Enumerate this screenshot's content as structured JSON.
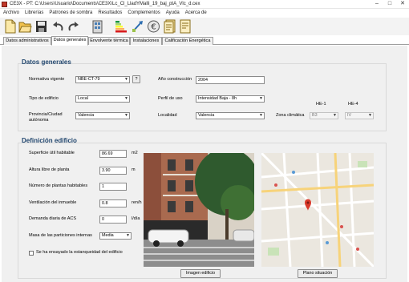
{
  "window": {
    "title": "CE3X - PT: C:\\Users\\Usuario\\Documents\\CE3X\\Lc_Cl_LladYMalli_19_baj_ptA_Vlc_d.cex",
    "controls": [
      "–",
      "□",
      "✕"
    ]
  },
  "menu": [
    "Archivo",
    "Librerías",
    "Patrones de sombra",
    "Resultados",
    "Complementos",
    "Ayuda",
    "Acerca de"
  ],
  "toolbar": [
    "new-file-icon",
    "open-file-icon",
    "save-icon",
    "undo-icon",
    "redo-icon",
    "building-icon",
    "energy-rating-icon",
    "measures-icon",
    "euro-icon",
    "report-icon",
    "certificate-icon"
  ],
  "tabs": [
    "Datos administrativos",
    "Datos generales",
    "Envolvente térmica",
    "Instalaciones",
    "Calificación Energética"
  ],
  "active_tab": "Datos generales",
  "general": {
    "title": "Datos generales",
    "normativa_label": "Normativa vigente",
    "normativa_value": "NBE-CT-79",
    "help_label": "?",
    "anio_label": "Año construcción",
    "anio_value": "2004",
    "tipo_label": "Tipo de edificio",
    "tipo_value": "Local",
    "perfil_label": "Perfil de uso",
    "perfil_value": "Intensidad Baja - 8h",
    "provincia_label": "Provincia/Ciudad autónoma",
    "provincia_value": "Valencia",
    "localidad_label": "Localidad",
    "localidad_value": "Valencia",
    "zona_label": "Zona climática",
    "he1_header": "HE-1",
    "he4_header": "HE-4",
    "he1_value": "B3",
    "he4_value": "IV"
  },
  "definicion": {
    "title": "Definición edificio",
    "superficie_label": "Superficie útil habitable",
    "superficie_value": "86.69",
    "superficie_unit": "m2",
    "altura_label": "Altura libre de planta",
    "altura_value": "3.90",
    "altura_unit": "m",
    "plantas_label": "Número de plantas habitables",
    "plantas_value": "1",
    "ventilacion_label": "Ventilación del inmueble",
    "ventilacion_value": "0.8",
    "ventilacion_unit": "ren/h",
    "acs_label": "Demanda diaria de ACS",
    "acs_value": "0",
    "acs_unit": "l/día",
    "masa_label": "Masa de las particiones internas",
    "masa_value": "Media",
    "estanqueidad_label": "Se ha ensayado la estanqueidad del edificio",
    "estanqueidad_checked": false,
    "image_button": "Imagen edificio",
    "plan_button": "Plano situación"
  }
}
